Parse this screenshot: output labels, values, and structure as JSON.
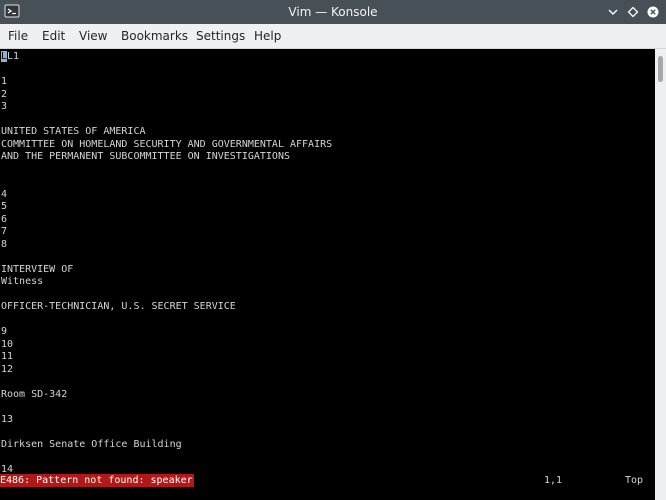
{
  "window": {
    "title": "Vim — Konsole",
    "app_icon": "terminal-icon",
    "controls": [
      "minimize-icon",
      "maximize-icon",
      "close-icon"
    ]
  },
  "menu": {
    "items": [
      "File",
      "Edit",
      "View",
      "Bookmarks",
      "Settings",
      "Help"
    ]
  },
  "terminal": {
    "background": "#000000",
    "foreground": "#d5d5d5",
    "cursor_color": "#8fb3d8",
    "first_line": {
      "cursor_char": "L",
      "rest": "L1"
    },
    "lines": [
      "",
      "1",
      "2",
      "3",
      "",
      "UNITED STATES OF AMERICA",
      "COMMITTEE ON HOMELAND SECURITY AND GOVERNMENTAL AFFAIRS",
      "AND THE PERMANENT SUBCOMMITTEE ON INVESTIGATIONS",
      "",
      "",
      "4",
      "5",
      "6",
      "7",
      "8",
      "",
      "INTERVIEW OF",
      "Witness",
      "",
      "OFFICER-TECHNICIAN, U.S. SECRET SERVICE",
      "",
      "9",
      "10",
      "11",
      "12",
      "",
      "Room SD-342",
      "",
      "13",
      "",
      "Dirksen Senate Office Building",
      "",
      "14"
    ],
    "status": {
      "error_message": "E486: Pattern not found: speaker",
      "error_color": "#b21818",
      "position": "1,1",
      "scroll": "Top"
    }
  }
}
